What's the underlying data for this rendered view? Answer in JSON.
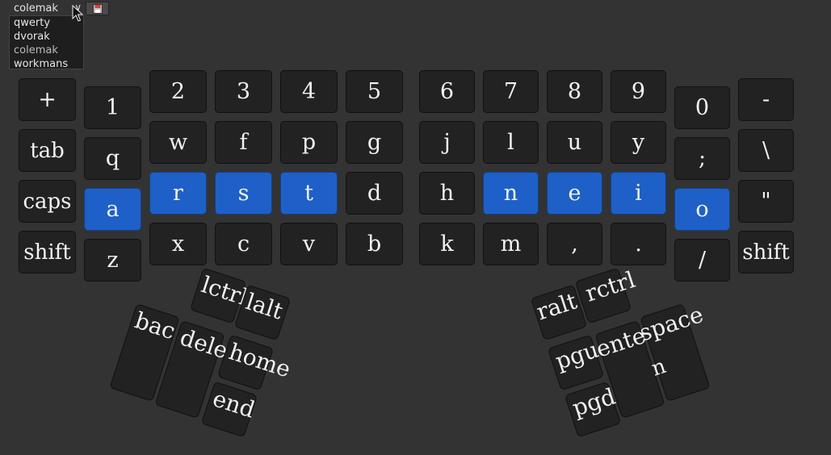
{
  "layout_selector": {
    "selected": "colemak",
    "options": [
      "qwerty",
      "dvorak",
      "colemak",
      "workmans"
    ]
  },
  "keys": {
    "plus": "+",
    "k1": "1",
    "k2": "2",
    "k3": "3",
    "k4": "4",
    "k5": "5",
    "k6": "6",
    "k7": "7",
    "k8": "8",
    "k9": "9",
    "k0": "0",
    "minus": "-",
    "tab": "tab",
    "q": "q",
    "w": "w",
    "f": "f",
    "p": "p",
    "g": "g",
    "j": "j",
    "l": "l",
    "u": "u",
    "y": "y",
    "semicolon": ";",
    "backslash": "\\",
    "caps": "caps",
    "a": "a",
    "r": "r",
    "s": "s",
    "t": "t",
    "d": "d",
    "h": "h",
    "n": "n",
    "e": "e",
    "i": "i",
    "o": "o",
    "quote": "\"",
    "lshift": "shift",
    "z": "z",
    "x": "x",
    "c": "c",
    "v": "v",
    "b": "b",
    "k": "k",
    "m": "m",
    "comma": ",",
    "period": ".",
    "slash": "/",
    "rshift": "shift"
  },
  "thumbs": {
    "lctrl": "lctrl",
    "lalt": "lalt",
    "backspace": "bac",
    "delete": "dele",
    "home": "home",
    "end": "end",
    "ralt": "ralt",
    "rctrl": "rctrl",
    "pgup": "pgu",
    "enter": "ente",
    "space": "space",
    "pgdn": "pgd",
    "enter_fragment": "n"
  },
  "colors": {
    "background": "#333333",
    "key": "#222222",
    "home_row": "#1e60c8"
  }
}
